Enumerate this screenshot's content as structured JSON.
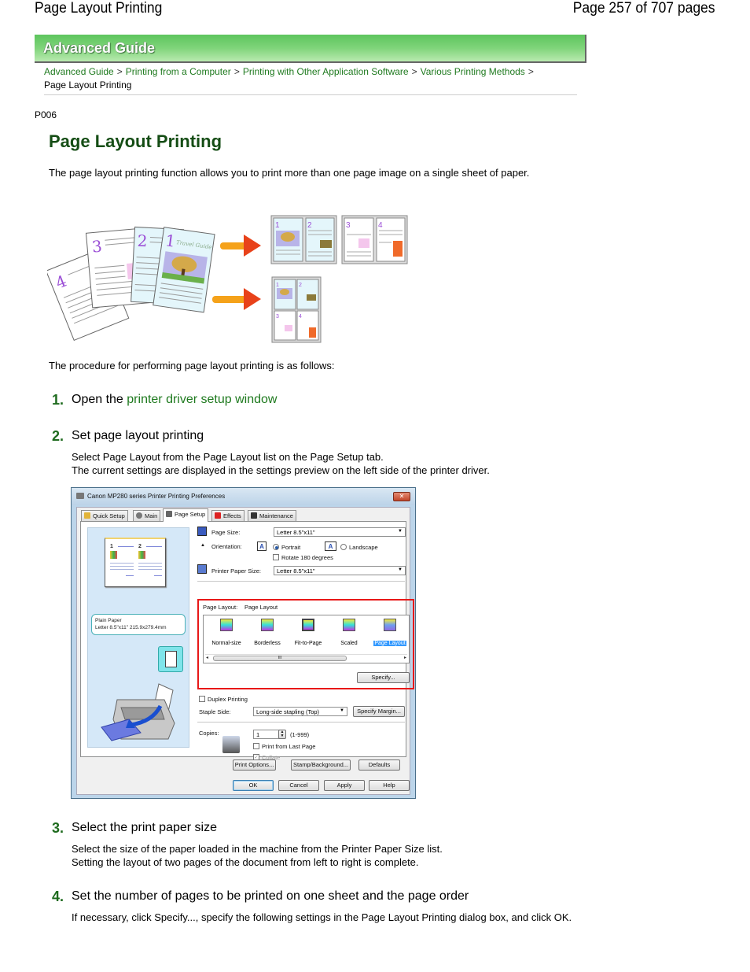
{
  "page_header": {
    "left": "Page Layout Printing",
    "right": "Page 257 of 707 pages"
  },
  "banner": {
    "title": "Advanced Guide"
  },
  "breadcrumb": {
    "links": [
      "Advanced Guide",
      "Printing from a Computer",
      "Printing with Other Application Software",
      "Various Printing Methods"
    ],
    "separator": ">",
    "current": "Page Layout Printing"
  },
  "doc_code": "P006",
  "title": "Page Layout Printing",
  "intro": "The page layout printing function allows you to print more than one page image on a single sheet of paper.",
  "illustration": {
    "description": "Four document pages combined onto sheets (2 pages per sheet and 4 pages per sheet)",
    "source_pages": [
      "4",
      "3",
      "2",
      "1"
    ],
    "source_page_1_heading": "Travel Guide"
  },
  "procedure_intro": "The procedure for performing page layout printing is as follows:",
  "steps": [
    {
      "num": "1.",
      "title_prefix": "Open the ",
      "title_link": "printer driver setup window"
    },
    {
      "num": "2.",
      "title": "Set page layout printing",
      "body": [
        "Select Page Layout from the Page Layout list on the Page Setup tab.",
        "The current settings are displayed in the settings preview on the left side of the printer driver."
      ]
    },
    {
      "num": "3.",
      "title": "Select the print paper size",
      "body": [
        "Select the size of the paper loaded in the machine from the Printer Paper Size list.",
        "Setting the layout of two pages of the document from left to right is complete."
      ]
    },
    {
      "num": "4.",
      "title": "Set the number of pages to be printed on one sheet and the page order",
      "body": [
        "If necessary, click Specify..., specify the following settings in the Page Layout Printing dialog box, and click OK."
      ]
    }
  ],
  "dialog": {
    "title": "Canon MP280 series Printer Printing Preferences",
    "close": "✕",
    "tabs": [
      "Quick Setup",
      "Main",
      "Page Setup",
      "Effects",
      "Maintenance"
    ],
    "active_tab": "Page Setup",
    "preview": {
      "page_nums": [
        "1",
        "2"
      ],
      "paper_type": "Plain Paper",
      "paper_size": "Letter 8.5\"x11\" 215.9x279.4mm"
    },
    "page_size_label": "Page Size:",
    "page_size_value": "Letter 8.5\"x11\"",
    "orientation_label": "Orientation:",
    "portrait_label": "Portrait",
    "landscape_label": "Landscape",
    "orientation_selected": "Portrait",
    "rotate_label": "Rotate 180 degrees",
    "rotate_checked": false,
    "printer_paper_size_label": "Printer Paper Size:",
    "printer_paper_size_value": "Letter 8.5\"x11\"",
    "page_layout_label": "Page Layout:",
    "page_layout_value": "Page Layout",
    "layout_options": [
      "Normal-size",
      "Borderless",
      "Fit-to-Page",
      "Scaled",
      "Page Layout"
    ],
    "layout_selected": "Page Layout",
    "scroll_thumb_glyph": "III",
    "specify_button": "Specify...",
    "duplex_label": "Duplex Printing",
    "duplex_checked": false,
    "staple_side_label": "Staple Side:",
    "staple_side_value": "Long-side stapling (Top)",
    "specify_margin_button": "Specify Margin...",
    "copies_label": "Copies:",
    "copies_value": "1",
    "copies_range": "(1-999)",
    "print_from_last_label": "Print from Last Page",
    "print_from_last_checked": false,
    "collate_label": "Collate",
    "collate_checked": true,
    "collate_disabled": true,
    "print_options_button": "Print Options...",
    "stamp_button": "Stamp/Background...",
    "defaults_button": "Defaults",
    "ok_button": "OK",
    "cancel_button": "Cancel",
    "apply_button": "Apply",
    "help_button": "Help",
    "highlight_color": "#e81818"
  },
  "colors": {
    "link": "#1f7a1f",
    "title": "#154d15",
    "step_number": "#1e6b1e",
    "banner": "#6dcc6a"
  }
}
